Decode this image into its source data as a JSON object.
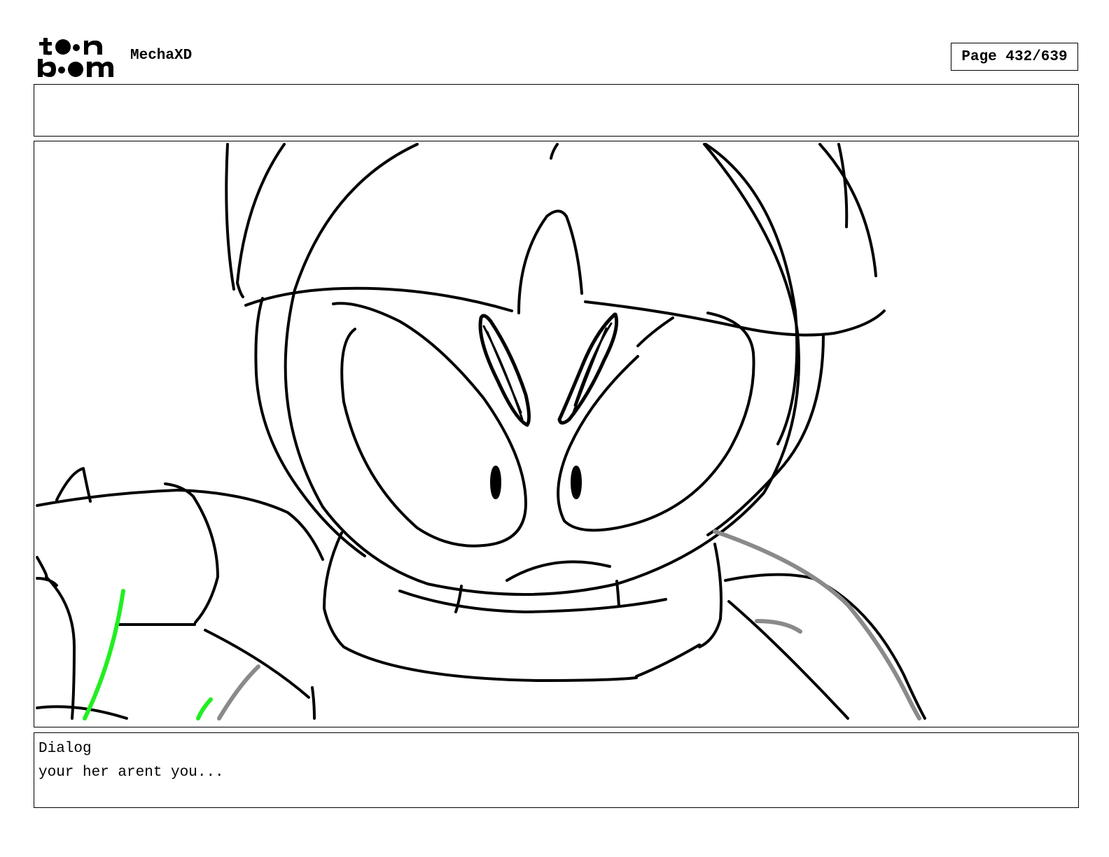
{
  "header": {
    "logo_line1": "toon",
    "logo_line2": "boom",
    "project_title": "MechaXD",
    "page_label": "Page 432/639"
  },
  "notes": {
    "text": ""
  },
  "panel": {
    "drawing": "storyboard-sketch"
  },
  "dialog": {
    "heading": "Dialog",
    "text": "your her arent you..."
  },
  "colors": {
    "line": "#000000",
    "gray_line": "#8a8a8a",
    "green_line": "#22ee22"
  }
}
